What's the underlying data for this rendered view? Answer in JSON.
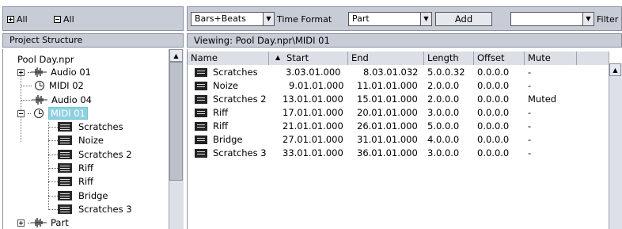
{
  "left_toolbar": {
    "expand_all_label": "All",
    "collapse_all_label": "All"
  },
  "project_structure": {
    "header": "Project Structure",
    "root": "Pool Day.npr",
    "tracks": [
      {
        "name": "Audio 01",
        "type": "audio",
        "expander": "plus"
      },
      {
        "name": "MIDI 02",
        "type": "midi",
        "expander": "none"
      },
      {
        "name": "Audio 04",
        "type": "audio",
        "expander": "none"
      },
      {
        "name": "MIDI 01",
        "type": "midi",
        "expander": "minus",
        "selected": true
      }
    ],
    "parts": [
      "Scratches",
      "Noize",
      "Scratches 2",
      "Riff",
      "Riff",
      "Bridge",
      "Scratches 3"
    ],
    "last_track": {
      "name": "Part",
      "type": "audio",
      "expander": "plus"
    }
  },
  "toolbar": {
    "time_format_value": "Bars+Beats",
    "time_format_label": "Time Format",
    "part_value": "Part",
    "add_label": "Add",
    "filter_value": "",
    "filter_label": "Filter"
  },
  "viewing": "Viewing: Pool Day.npr\\MIDI 01",
  "table": {
    "columns": [
      "Name",
      "Start",
      "End",
      "Length",
      "Offset",
      "Mute"
    ],
    "rows": [
      {
        "name": "Scratches",
        "start": "3.03.01.000",
        "end": "8.03.01.032",
        "length": "5.0.0.32",
        "offset": "0.0.0.0",
        "mute": "-"
      },
      {
        "name": "Noize",
        "start": "9.01.01.000",
        "end": "11.01.01.000",
        "length": "2.0.0.0",
        "offset": "0.0.0.0",
        "mute": "-"
      },
      {
        "name": "Scratches 2",
        "start": "13.01.01.000",
        "end": "15.01.01.000",
        "length": "2.0.0.0",
        "offset": "0.0.0.0",
        "mute": "Muted"
      },
      {
        "name": "Riff",
        "start": "17.01.01.000",
        "end": "20.01.01.000",
        "length": "3.0.0.0",
        "offset": "0.0.0.0",
        "mute": "-"
      },
      {
        "name": "Riff",
        "start": "21.01.01.000",
        "end": "26.01.01.000",
        "length": "5.0.0.0",
        "offset": "0.0.0.0",
        "mute": "-"
      },
      {
        "name": "Bridge",
        "start": "27.01.01.000",
        "end": "31.01.01.000",
        "length": "4.0.0.0",
        "offset": "0.0.0.0",
        "mute": "-"
      },
      {
        "name": "Scratches 3",
        "start": "33.01.01.000",
        "end": "36.01.01.000",
        "length": "3.0.0.0",
        "offset": "0.0.0.0",
        "mute": "-"
      }
    ]
  }
}
